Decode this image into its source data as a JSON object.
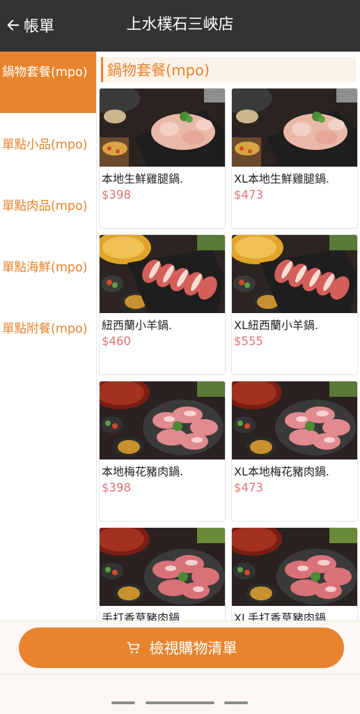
{
  "header": {
    "back_label": "帳單",
    "title": "上水樸石三峽店"
  },
  "sidebar": {
    "items": [
      {
        "label": "鍋物套餐(mpo)",
        "active": true
      },
      {
        "label": "單點小品(mpo)",
        "active": false
      },
      {
        "label": "單點肉品(mpo)",
        "active": false
      },
      {
        "label": "單點海鮮(mpo)",
        "active": false
      },
      {
        "label": "單點附餐(mpo)",
        "active": false
      }
    ]
  },
  "section": {
    "title": "鍋物套餐(mpo)"
  },
  "products": [
    {
      "name": "本地生鮮雞腿鍋.",
      "price": "$398",
      "image": "chicken"
    },
    {
      "name": "XL本地生鮮雞腿鍋.",
      "price": "$473",
      "image": "chicken"
    },
    {
      "name": "紐西蘭小羊鍋.",
      "price": "$460",
      "image": "lamb"
    },
    {
      "name": "XL紐西蘭小羊鍋.",
      "price": "$555",
      "image": "lamb"
    },
    {
      "name": "本地梅花豬肉鍋.",
      "price": "$398",
      "image": "pork"
    },
    {
      "name": "XL本地梅花豬肉鍋.",
      "price": "$473",
      "image": "pork"
    },
    {
      "name": "手打香草豬肉鍋.",
      "price": "",
      "image": "herb-pork"
    },
    {
      "name": "XL手打香草豬肉鍋.",
      "price": "",
      "image": "herb-pork"
    }
  ],
  "footer": {
    "cart_label": "檢視購物清單"
  },
  "colors": {
    "accent": "#e8842e",
    "header_bg": "#333333",
    "price": "#e07476"
  }
}
